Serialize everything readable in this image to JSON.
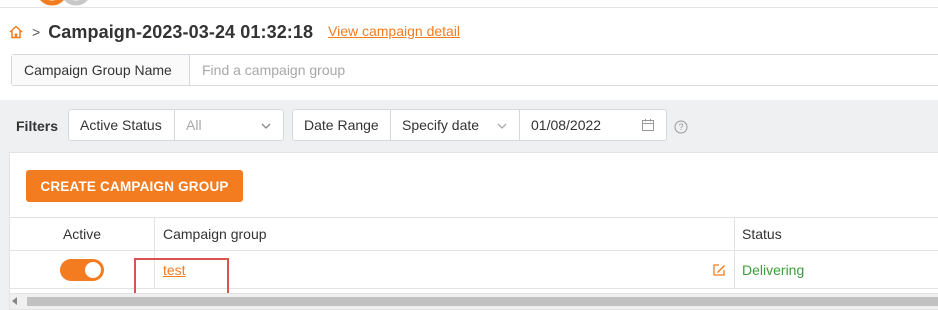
{
  "header": {
    "title": "Campaign-2023-03-24 01:32:18",
    "detail_link": "View campaign detail",
    "breadcrumb_separator": ">"
  },
  "search": {
    "label": "Campaign Group Name",
    "placeholder": "Find a campaign group",
    "value": ""
  },
  "filters": {
    "label": "Filters",
    "active_status": {
      "label": "Active Status",
      "value": "All"
    },
    "date_range": {
      "label": "Date Range",
      "mode": "Specify date",
      "date": "01/08/2022"
    }
  },
  "actions": {
    "create_label": "CREATE CAMPAIGN GROUP"
  },
  "table": {
    "columns": [
      "Active",
      "Campaign group",
      "Status"
    ],
    "rows": [
      {
        "active": true,
        "campaign_group": "test",
        "status": "Delivering"
      }
    ]
  },
  "colors": {
    "accent": "#f47c20",
    "status_delivering": "#3c9c3c",
    "highlight": "#d9534f"
  }
}
